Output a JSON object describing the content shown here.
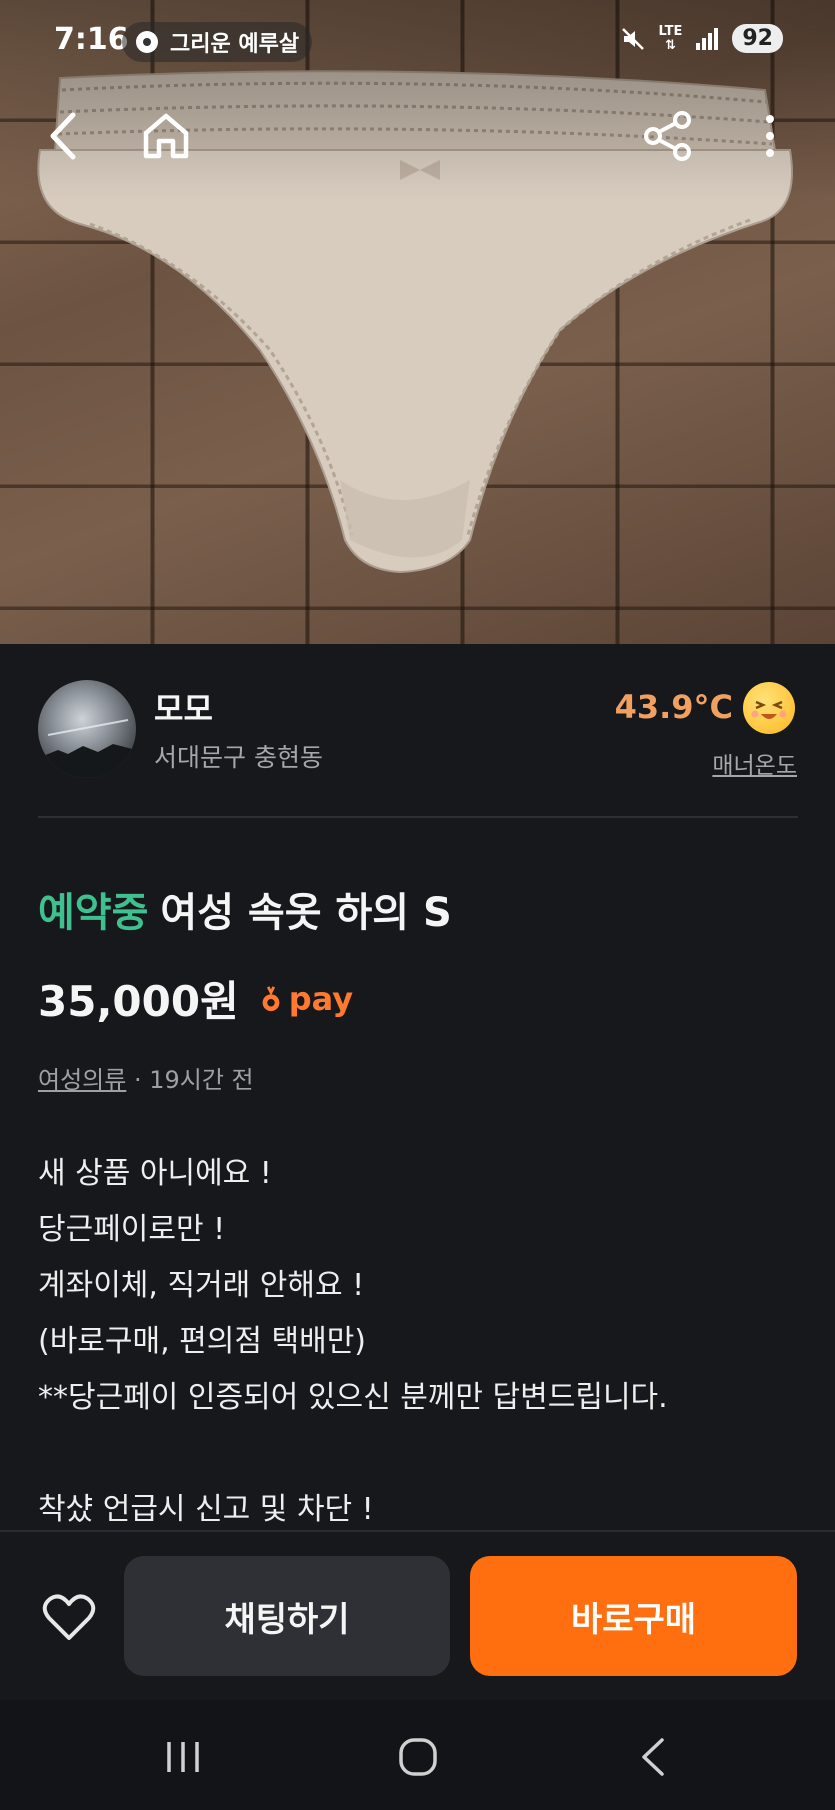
{
  "status_bar": {
    "time": "7:16",
    "media_title": "그리운 예루살",
    "network": "LTE",
    "battery": "92"
  },
  "hero": {
    "icons": [
      "back-icon",
      "home-icon",
      "share-icon",
      "more-icon"
    ]
  },
  "seller": {
    "name": "모모",
    "location": "서대문구 충현동",
    "temperature": "43.9°C",
    "manner_label": "매너온도"
  },
  "listing": {
    "status": "예약중",
    "title": "여성 속옷 하의 S",
    "price": "35,000원",
    "pay_label": "pay",
    "category": "여성의류",
    "time_ago": " · 19시간 전",
    "description": [
      "새 상품 아니에요 !",
      "당근페이로만 !",
      "계좌이체, 직거래 안해요 !",
      "(바로구매, 편의점 택배만)",
      "**당근페이 인증되어 있으신 분께만 답변드립니다.",
      "",
      "착샸 언급시 신고 및 차단 !"
    ]
  },
  "actions": {
    "chat_label": "채팅하기",
    "buy_label": "바로구매"
  },
  "colors": {
    "background": "#17181c",
    "reserved_green": "#3fc08f",
    "accent_orange": "#ff6f0f",
    "temperature_orange": "#f0a060"
  }
}
